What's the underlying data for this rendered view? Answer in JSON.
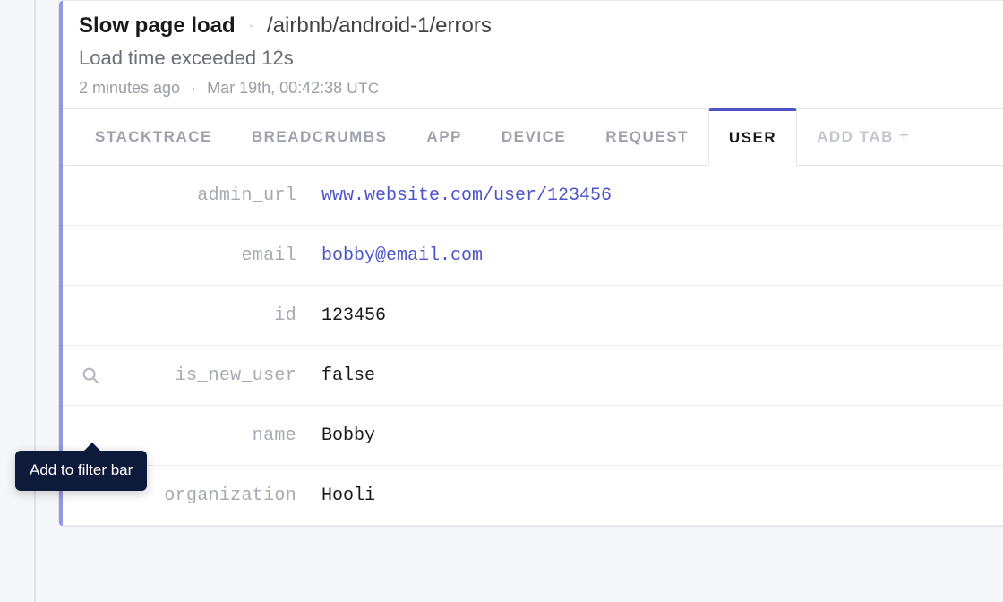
{
  "header": {
    "title": "Slow page load",
    "path": "/airbnb/android-1/errors",
    "description": "Load time exceeded 12s",
    "relative_time": "2 minutes ago",
    "absolute_time": "Mar 19th, 00:42:38",
    "tz": "UTC"
  },
  "tabs": [
    {
      "id": "stacktrace",
      "label": "STACKTRACE",
      "active": false
    },
    {
      "id": "breadcrumbs",
      "label": "BREADCRUMBS",
      "active": false
    },
    {
      "id": "app",
      "label": "APP",
      "active": false
    },
    {
      "id": "device",
      "label": "DEVICE",
      "active": false
    },
    {
      "id": "request",
      "label": "REQUEST",
      "active": false
    },
    {
      "id": "user",
      "label": "USER",
      "active": true
    }
  ],
  "add_tab_label": "ADD TAB",
  "rows": [
    {
      "key": "admin_url",
      "value": "www.website.com/user/123456",
      "link": true
    },
    {
      "key": "email",
      "value": "bobby@email.com",
      "link": true
    },
    {
      "key": "id",
      "value": "123456",
      "link": false
    },
    {
      "key": "is_new_user",
      "value": "false",
      "link": false,
      "hover": true
    },
    {
      "key": "name",
      "value": "Bobby",
      "link": false
    },
    {
      "key": "organization",
      "value": "Hooli",
      "link": false
    }
  ],
  "tooltip": "Add to filter bar"
}
